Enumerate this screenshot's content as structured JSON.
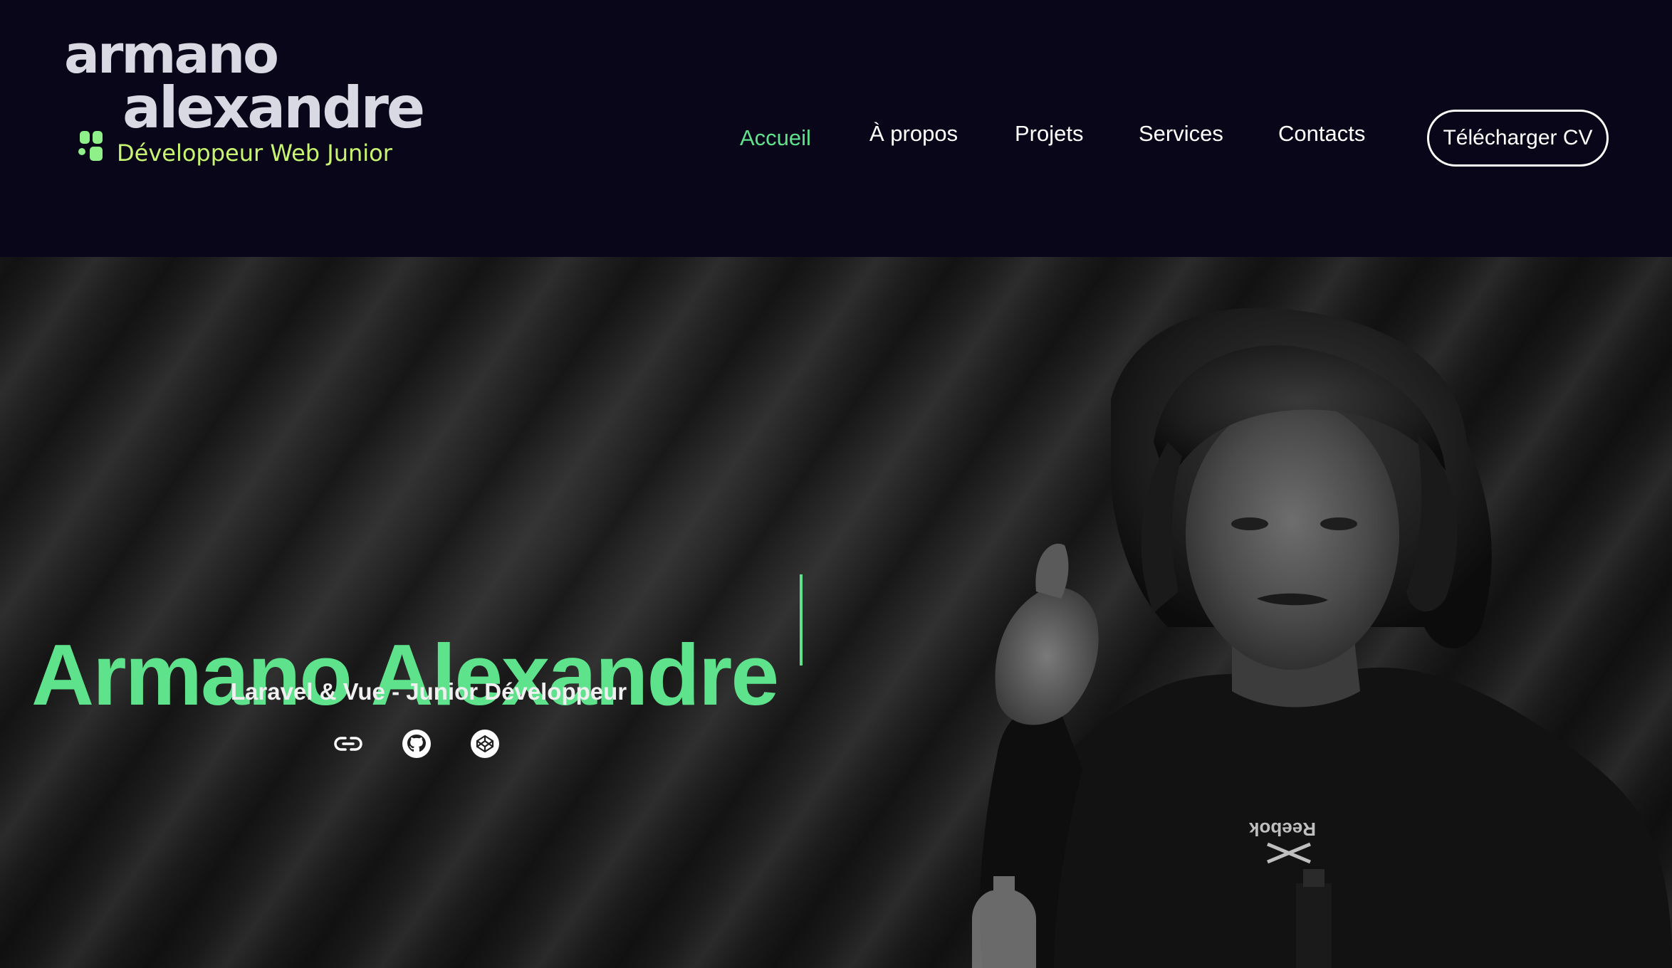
{
  "header": {
    "logo": {
      "line1": "armano",
      "line2": "alexandre",
      "subtitle": "Développeur Web Junior"
    },
    "nav": {
      "items": [
        {
          "label": "Accueil",
          "active": true
        },
        {
          "label": "À propos",
          "active": false
        },
        {
          "label": "Projets",
          "active": false
        },
        {
          "label": "Services",
          "active": false
        },
        {
          "label": "Contacts",
          "active": false
        }
      ],
      "cv_button": "Télécharger CV"
    }
  },
  "hero": {
    "title": "Armano Alexandre",
    "subtitle": "Laravel & Vue - Junior Développeur",
    "social_icons": [
      "link-icon",
      "github-icon",
      "codepen-icon"
    ]
  },
  "colors": {
    "background": "#0a0619",
    "accent_green": "#5ee38c",
    "logo_subtitle": "#c8f56f",
    "logo_text": "#d9d9e3"
  }
}
